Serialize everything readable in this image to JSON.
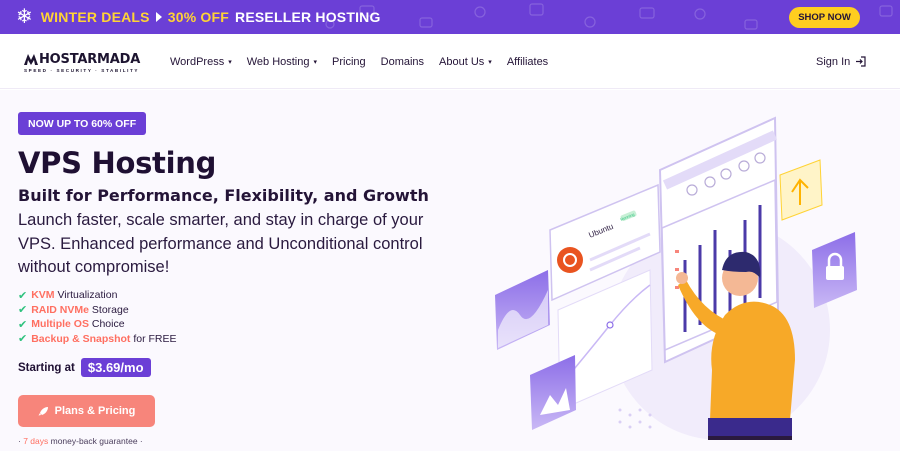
{
  "promo": {
    "deal_label": "WINTER DEALS",
    "offer_highlight": "30% OFF",
    "offer_rest": "RESELLER HOSTING",
    "shop_label": "SHOP NOW"
  },
  "header": {
    "logo_name": "HOSTARMADA",
    "logo_tagline": "SPEED · SECURITY · STABILITY",
    "nav": [
      {
        "label": "WordPress",
        "dropdown": "▾"
      },
      {
        "label": "Web Hosting",
        "dropdown": "▾"
      },
      {
        "label": "Pricing",
        "dropdown": ""
      },
      {
        "label": "Domains",
        "dropdown": ""
      },
      {
        "label": "About Us",
        "dropdown": "▾"
      },
      {
        "label": "Affiliates",
        "dropdown": ""
      }
    ],
    "signin_label": "Sign In"
  },
  "hero": {
    "badge": "NOW UP TO 60% OFF",
    "title": "VPS Hosting",
    "subtitle": "Built for Performance, Flexibility, and Growth",
    "description": "Launch faster, scale smarter, and stay in charge of your VPS. Enhanced performance and Unconditional control without compromise!",
    "features": [
      {
        "highlight": "KVM",
        "rest": " Virtualization"
      },
      {
        "highlight": "RAID NVMe",
        "rest": " Storage"
      },
      {
        "highlight": "Multiple OS",
        "rest": " Choice"
      },
      {
        "highlight": "Backup & Snapshot",
        "rest": " for FREE"
      }
    ],
    "starting_label": "Starting at",
    "price": "$3.69/mo",
    "cta_label": "Plans & Pricing",
    "guarantee_prefix": "· ",
    "guarantee_days": "7 days",
    "guarantee_rest": " money-back guarantee ·",
    "screen_os_label": "Ubuntu",
    "screen_status": "Running"
  },
  "colors": {
    "brand_purple": "#6b3fd6",
    "accent_yellow": "#ffce1f",
    "cta_coral": "#f7857b",
    "check_green": "#2ec27e"
  },
  "icons": {
    "promo": "snowflake-icon",
    "signin": "sign-in-icon",
    "cta": "rocket-icon",
    "feature": "check-icon"
  }
}
